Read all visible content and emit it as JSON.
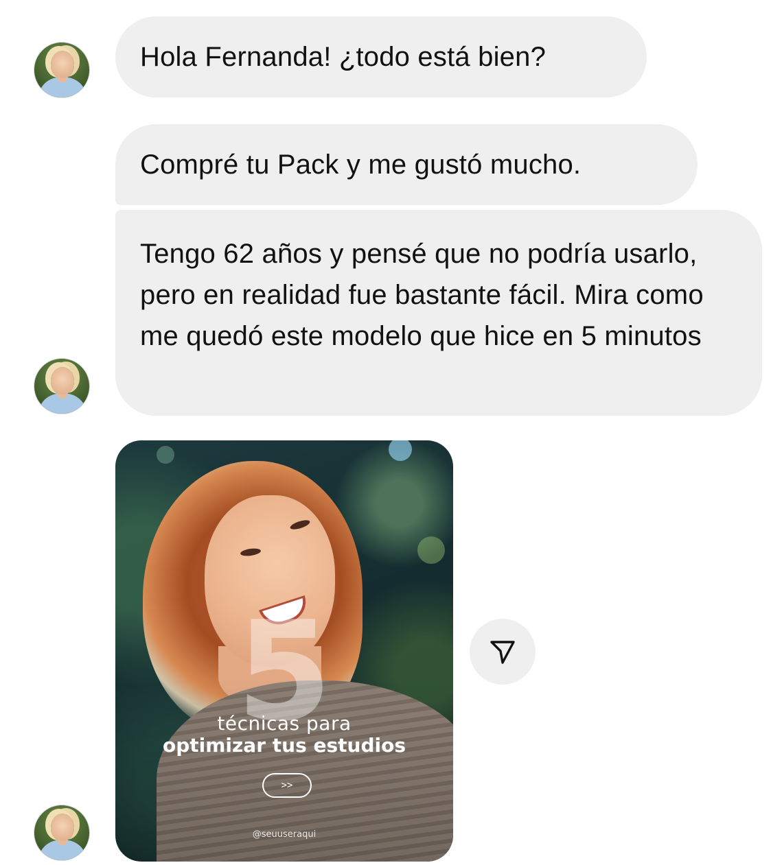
{
  "messages": [
    {
      "text": "Hola Fernanda! ¿todo está bien?"
    },
    {
      "text": "Compré tu Pack y me gustó mucho."
    },
    {
      "text": "Tengo 62 años y pensé que no podría usarlo, pero en realidad fue bastante fácil. Mira como me quedó este modelo que hice en 5 minutos"
    }
  ],
  "shared_post": {
    "number": "5",
    "line1": "técnicas para",
    "line2": "optimizar tus estudios",
    "button_label": ">>",
    "handle": "@seuuseraqui"
  },
  "icons": {
    "avatar": "contact-avatar",
    "share": "send-paper-plane-icon"
  },
  "colors": {
    "bubble": "#efefef",
    "text": "#111111",
    "background": "#ffffff"
  }
}
